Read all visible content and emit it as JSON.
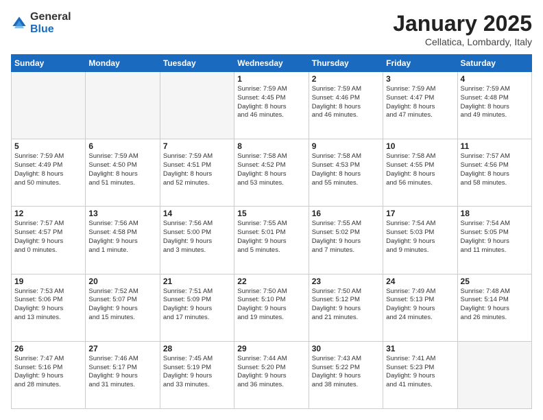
{
  "logo": {
    "general": "General",
    "blue": "Blue"
  },
  "title": "January 2025",
  "subtitle": "Cellatica, Lombardy, Italy",
  "days_header": [
    "Sunday",
    "Monday",
    "Tuesday",
    "Wednesday",
    "Thursday",
    "Friday",
    "Saturday"
  ],
  "weeks": [
    [
      {
        "num": "",
        "info": ""
      },
      {
        "num": "",
        "info": ""
      },
      {
        "num": "",
        "info": ""
      },
      {
        "num": "1",
        "info": "Sunrise: 7:59 AM\nSunset: 4:45 PM\nDaylight: 8 hours\nand 46 minutes."
      },
      {
        "num": "2",
        "info": "Sunrise: 7:59 AM\nSunset: 4:46 PM\nDaylight: 8 hours\nand 46 minutes."
      },
      {
        "num": "3",
        "info": "Sunrise: 7:59 AM\nSunset: 4:47 PM\nDaylight: 8 hours\nand 47 minutes."
      },
      {
        "num": "4",
        "info": "Sunrise: 7:59 AM\nSunset: 4:48 PM\nDaylight: 8 hours\nand 49 minutes."
      }
    ],
    [
      {
        "num": "5",
        "info": "Sunrise: 7:59 AM\nSunset: 4:49 PM\nDaylight: 8 hours\nand 50 minutes."
      },
      {
        "num": "6",
        "info": "Sunrise: 7:59 AM\nSunset: 4:50 PM\nDaylight: 8 hours\nand 51 minutes."
      },
      {
        "num": "7",
        "info": "Sunrise: 7:59 AM\nSunset: 4:51 PM\nDaylight: 8 hours\nand 52 minutes."
      },
      {
        "num": "8",
        "info": "Sunrise: 7:58 AM\nSunset: 4:52 PM\nDaylight: 8 hours\nand 53 minutes."
      },
      {
        "num": "9",
        "info": "Sunrise: 7:58 AM\nSunset: 4:53 PM\nDaylight: 8 hours\nand 55 minutes."
      },
      {
        "num": "10",
        "info": "Sunrise: 7:58 AM\nSunset: 4:55 PM\nDaylight: 8 hours\nand 56 minutes."
      },
      {
        "num": "11",
        "info": "Sunrise: 7:57 AM\nSunset: 4:56 PM\nDaylight: 8 hours\nand 58 minutes."
      }
    ],
    [
      {
        "num": "12",
        "info": "Sunrise: 7:57 AM\nSunset: 4:57 PM\nDaylight: 9 hours\nand 0 minutes."
      },
      {
        "num": "13",
        "info": "Sunrise: 7:56 AM\nSunset: 4:58 PM\nDaylight: 9 hours\nand 1 minute."
      },
      {
        "num": "14",
        "info": "Sunrise: 7:56 AM\nSunset: 5:00 PM\nDaylight: 9 hours\nand 3 minutes."
      },
      {
        "num": "15",
        "info": "Sunrise: 7:55 AM\nSunset: 5:01 PM\nDaylight: 9 hours\nand 5 minutes."
      },
      {
        "num": "16",
        "info": "Sunrise: 7:55 AM\nSunset: 5:02 PM\nDaylight: 9 hours\nand 7 minutes."
      },
      {
        "num": "17",
        "info": "Sunrise: 7:54 AM\nSunset: 5:03 PM\nDaylight: 9 hours\nand 9 minutes."
      },
      {
        "num": "18",
        "info": "Sunrise: 7:54 AM\nSunset: 5:05 PM\nDaylight: 9 hours\nand 11 minutes."
      }
    ],
    [
      {
        "num": "19",
        "info": "Sunrise: 7:53 AM\nSunset: 5:06 PM\nDaylight: 9 hours\nand 13 minutes."
      },
      {
        "num": "20",
        "info": "Sunrise: 7:52 AM\nSunset: 5:07 PM\nDaylight: 9 hours\nand 15 minutes."
      },
      {
        "num": "21",
        "info": "Sunrise: 7:51 AM\nSunset: 5:09 PM\nDaylight: 9 hours\nand 17 minutes."
      },
      {
        "num": "22",
        "info": "Sunrise: 7:50 AM\nSunset: 5:10 PM\nDaylight: 9 hours\nand 19 minutes."
      },
      {
        "num": "23",
        "info": "Sunrise: 7:50 AM\nSunset: 5:12 PM\nDaylight: 9 hours\nand 21 minutes."
      },
      {
        "num": "24",
        "info": "Sunrise: 7:49 AM\nSunset: 5:13 PM\nDaylight: 9 hours\nand 24 minutes."
      },
      {
        "num": "25",
        "info": "Sunrise: 7:48 AM\nSunset: 5:14 PM\nDaylight: 9 hours\nand 26 minutes."
      }
    ],
    [
      {
        "num": "26",
        "info": "Sunrise: 7:47 AM\nSunset: 5:16 PM\nDaylight: 9 hours\nand 28 minutes."
      },
      {
        "num": "27",
        "info": "Sunrise: 7:46 AM\nSunset: 5:17 PM\nDaylight: 9 hours\nand 31 minutes."
      },
      {
        "num": "28",
        "info": "Sunrise: 7:45 AM\nSunset: 5:19 PM\nDaylight: 9 hours\nand 33 minutes."
      },
      {
        "num": "29",
        "info": "Sunrise: 7:44 AM\nSunset: 5:20 PM\nDaylight: 9 hours\nand 36 minutes."
      },
      {
        "num": "30",
        "info": "Sunrise: 7:43 AM\nSunset: 5:22 PM\nDaylight: 9 hours\nand 38 minutes."
      },
      {
        "num": "31",
        "info": "Sunrise: 7:41 AM\nSunset: 5:23 PM\nDaylight: 9 hours\nand 41 minutes."
      },
      {
        "num": "",
        "info": ""
      }
    ]
  ]
}
